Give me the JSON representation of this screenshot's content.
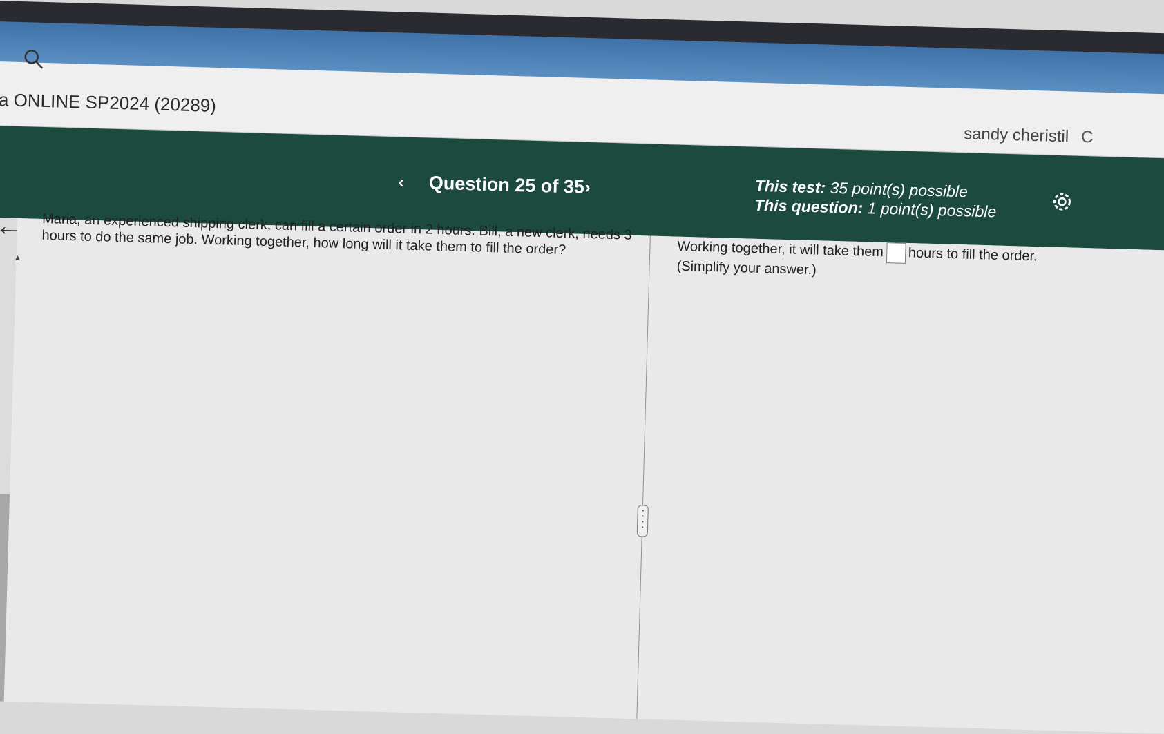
{
  "header": {
    "course_title": "a ONLINE SP2024 (20289)",
    "user_name": "sandy cheristil",
    "user_extra": "C"
  },
  "quiz": {
    "prev_label": "‹",
    "question_title": "Question 25 of 35",
    "next_label": "›",
    "test_points_label": "This test:",
    "test_points_value": "35 point(s) possible",
    "question_points_label": "This question:",
    "question_points_value": "1 point(s) possible"
  },
  "question": {
    "text": "Maria, an experienced shipping clerk, can fill a certain order in 2 hours. Bill, a new clerk, needs 3 hours to do the same job. Working together, how long will it take them to fill the order?"
  },
  "answer": {
    "prefix": "Working together, it will take them",
    "suffix": "hours to fill the order.",
    "note": "(Simplify your answer.)",
    "input_value": ""
  },
  "icons": [
    "search-icon",
    "back-arrow-icon",
    "gear-icon",
    "chevron-left-icon",
    "chevron-right-icon"
  ],
  "colors": {
    "quiz_bar": "#1c4a3e",
    "top_blue": "#4a7fb5"
  }
}
